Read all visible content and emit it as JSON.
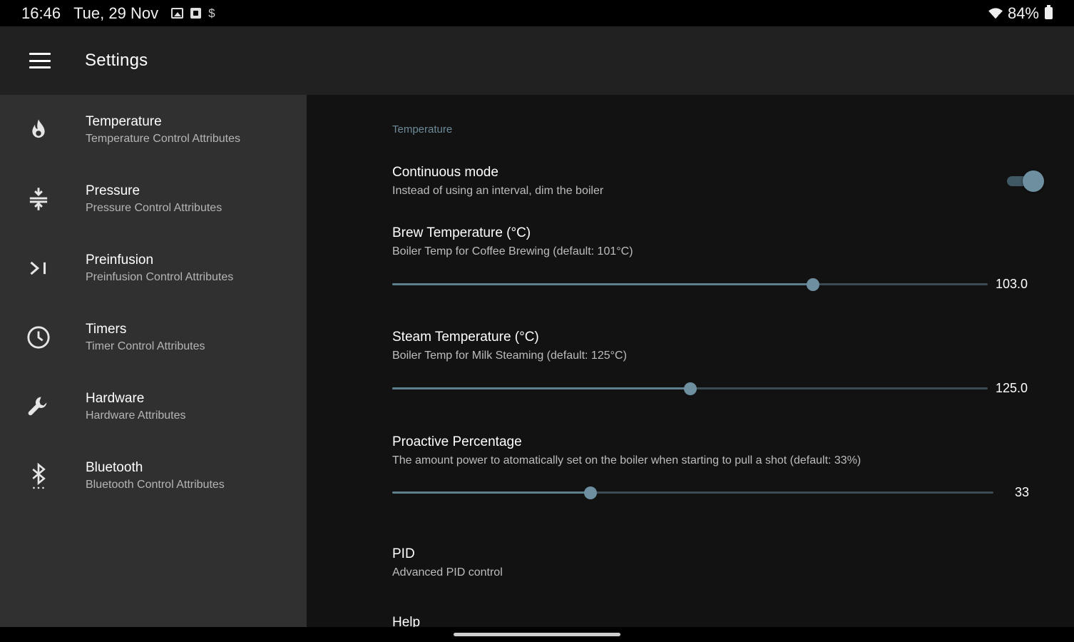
{
  "status_bar": {
    "time": "16:46",
    "date": "Tue, 29 Nov",
    "battery": "84%",
    "icons": [
      "image-icon",
      "app-box-icon",
      "dollar-icon",
      "wifi-icon",
      "battery-icon"
    ]
  },
  "appbar": {
    "title": "Settings",
    "menu_icon": "menu-icon"
  },
  "sidebar": {
    "items": [
      {
        "label": "Temperature",
        "subtitle": "Temperature Control Attributes",
        "icon": "flame-icon"
      },
      {
        "label": "Pressure",
        "subtitle": "Pressure Control Attributes",
        "icon": "compress-icon"
      },
      {
        "label": "Preinfusion",
        "subtitle": "Preinfusion Control Attributes",
        "icon": "skip-arrow-icon"
      },
      {
        "label": "Timers",
        "subtitle": "Timer Control Attributes",
        "icon": "clock-icon"
      },
      {
        "label": "Hardware",
        "subtitle": "Hardware Attributes",
        "icon": "wrench-icon"
      },
      {
        "label": "Bluetooth",
        "subtitle": "Bluetooth Control Attributes",
        "icon": "bluetooth-icon"
      }
    ]
  },
  "content": {
    "section_header": "Temperature",
    "continuous_mode": {
      "title": "Continuous mode",
      "subtitle": "Instead of using an interval, dim the boiler",
      "enabled": true
    },
    "brew_temperature": {
      "title": "Brew Temperature (°C)",
      "subtitle": "Boiler Temp for Coffee Brewing (default: 101°C)",
      "value": "103.0",
      "fraction": 0.707
    },
    "steam_temperature": {
      "title": "Steam Temperature (°C)",
      "subtitle": "Boiler Temp for Milk Steaming (default: 125°C)",
      "value": "125.0",
      "fraction": 0.501
    },
    "proactive_percentage": {
      "title": "Proactive Percentage",
      "subtitle": "The amount power to atomatically set on the boiler when starting to pull a shot (default: 33%)",
      "value": "33",
      "fraction": 0.33
    },
    "pid": {
      "title": "PID",
      "subtitle": "Advanced PID control"
    },
    "help": {
      "title": "Help"
    }
  },
  "colors": {
    "accent": "#6d8fa0",
    "track": "#3f5864",
    "section_header": "#6d8a98",
    "sidebar_bg": "#303030",
    "content_bg": "#121212",
    "appbar_bg": "#212121"
  }
}
